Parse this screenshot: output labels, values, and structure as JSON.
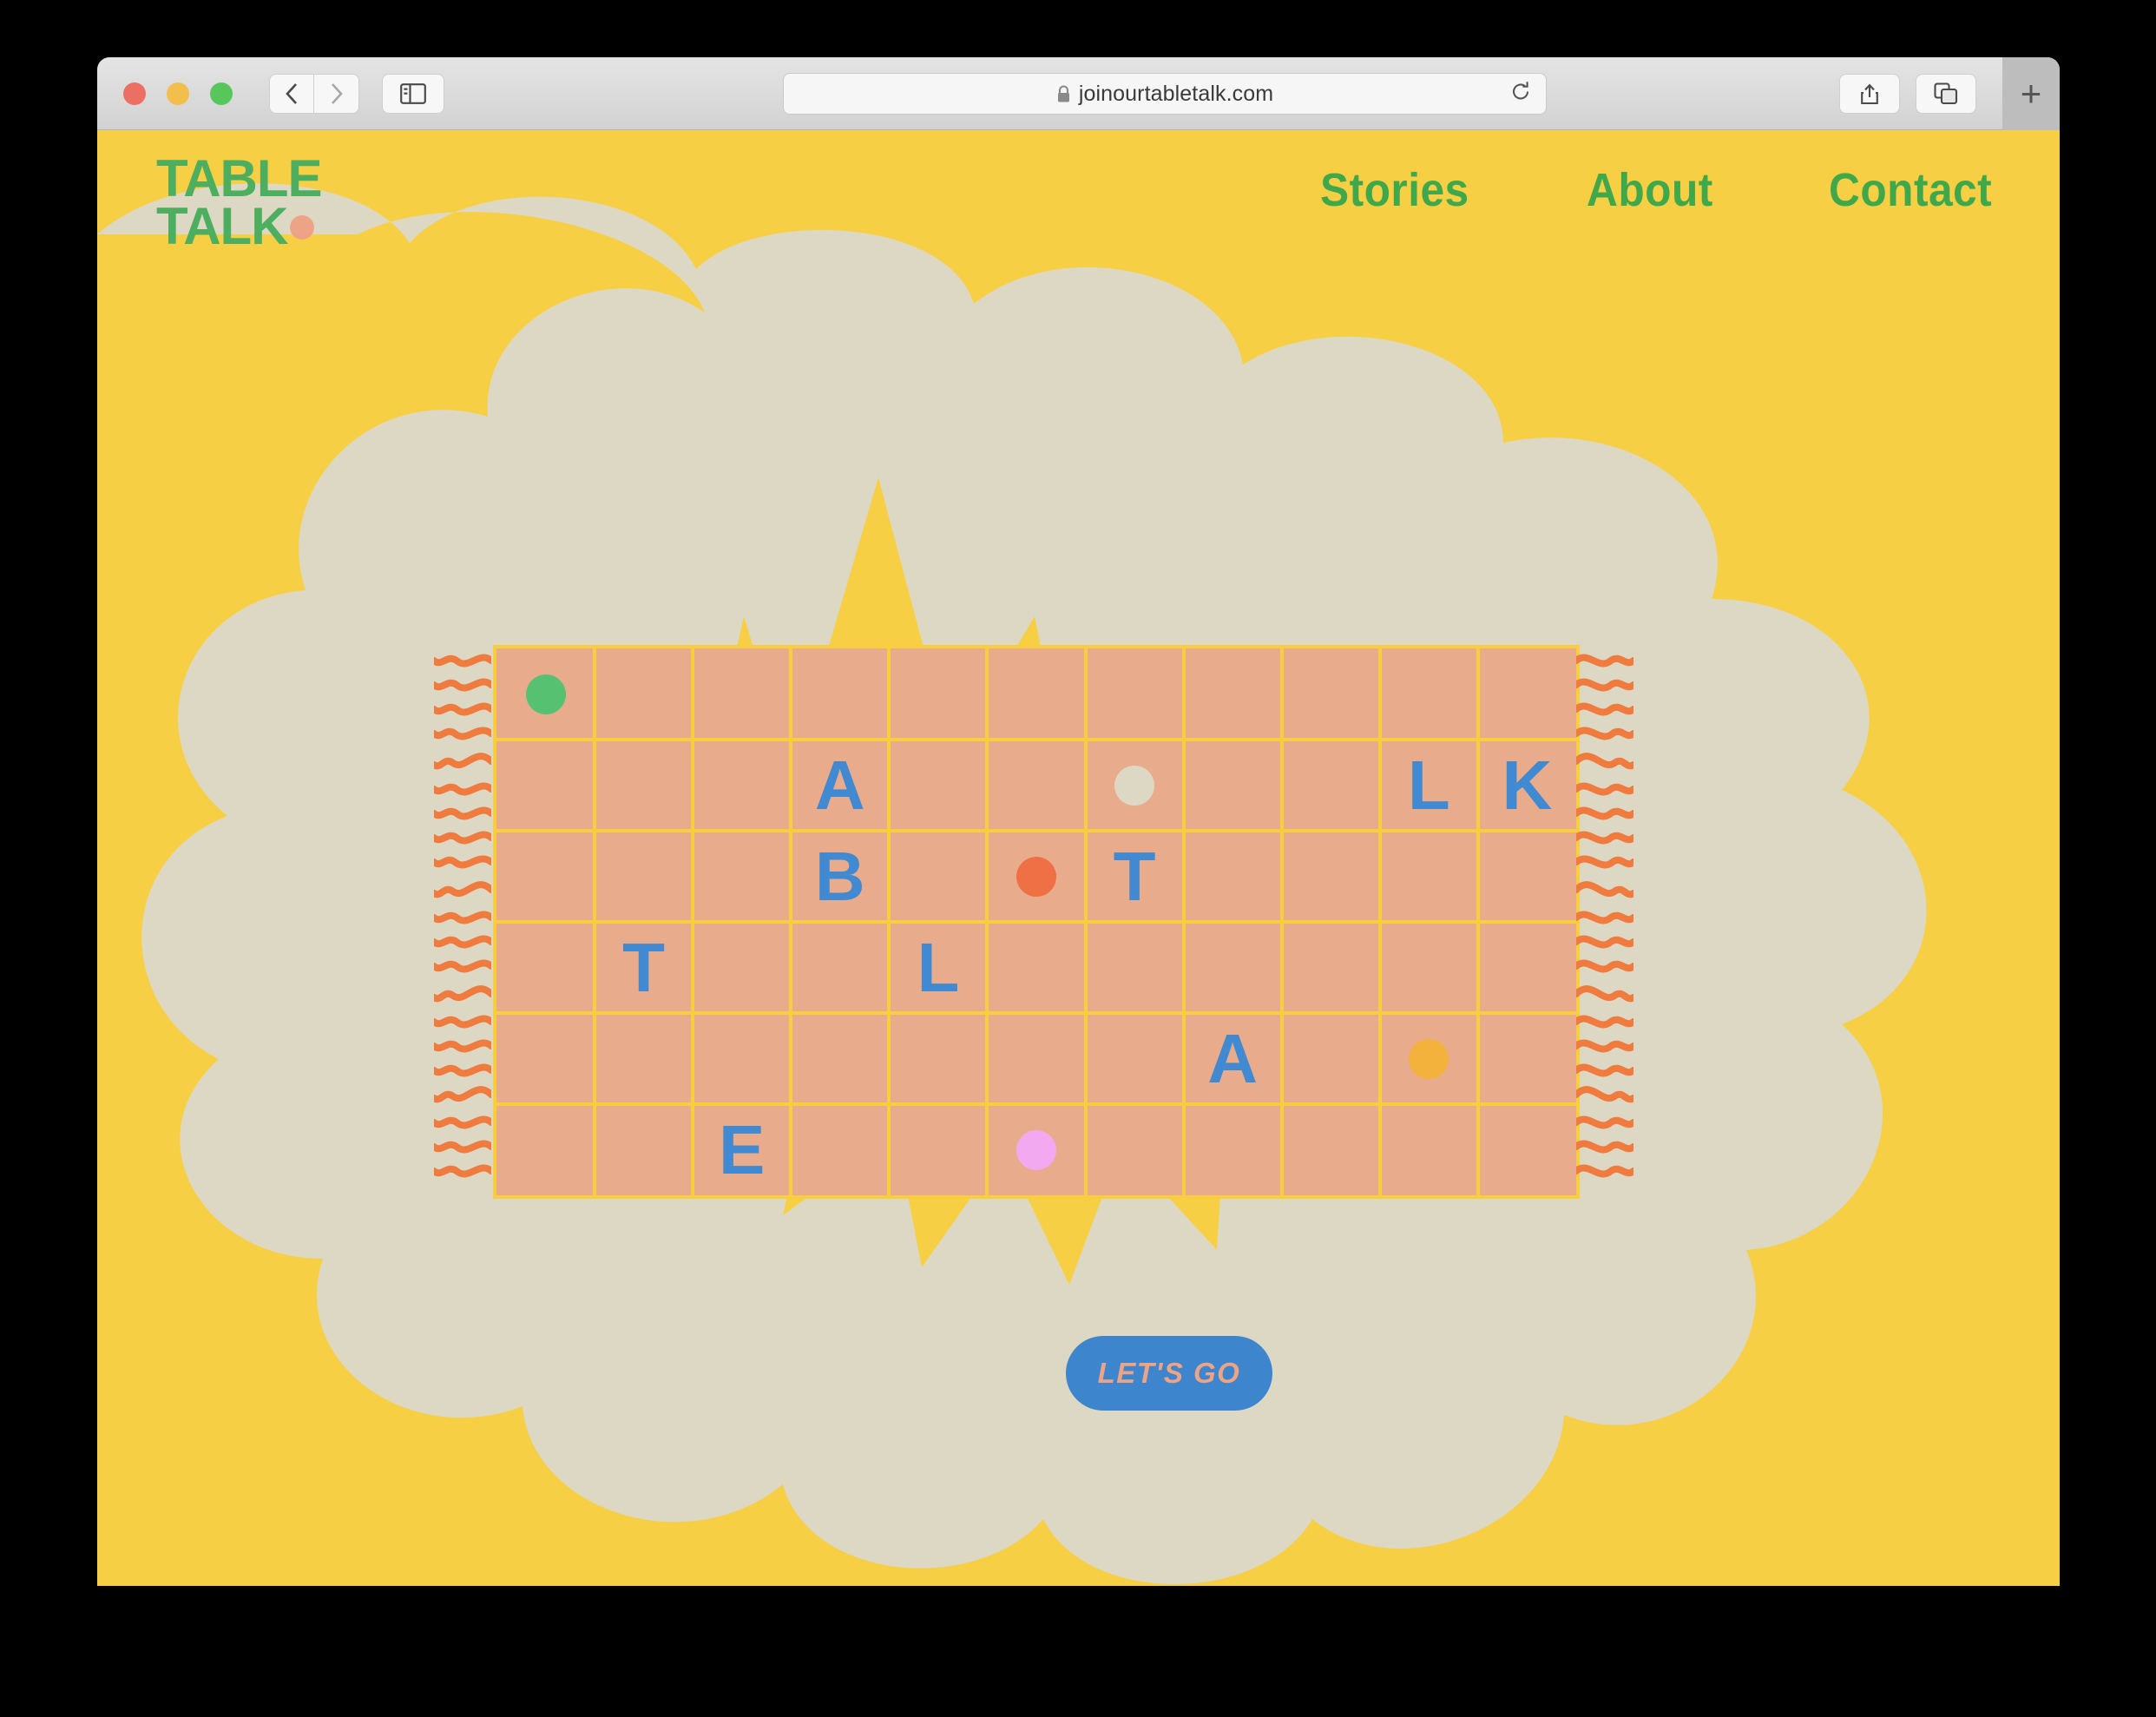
{
  "browser": {
    "url": "joinourtabletalk.com",
    "lock_icon": "lock-icon",
    "reload_icon": "reload-icon",
    "back_icon": "chevron-left-icon",
    "forward_icon": "chevron-right-icon",
    "sidebar_icon": "sidebar-icon",
    "share_icon": "share-icon",
    "tabs_icon": "tab-overview-icon",
    "new_tab_label": "+"
  },
  "site": {
    "logo": {
      "line1": "TABLE",
      "line2": "TALK"
    },
    "nav": [
      {
        "label": "Stories"
      },
      {
        "label": "About"
      },
      {
        "label": "Contact"
      }
    ],
    "cta": {
      "label": "LET'S GO"
    }
  },
  "colors": {
    "page_yellow": "#f7cf45",
    "cloud_beige": "#ddd8c4",
    "rug_salmon": "#e8ac8c",
    "rug_grid_yellow": "#f9ce3e",
    "letter_blue": "#4189d0",
    "brand_green": "#3fa84a",
    "accent_peach": "#eda385",
    "fringe_orange": "#ef7b3f",
    "cta_blue": "#3d85cc"
  },
  "rug": {
    "columns": 11,
    "rows": 6,
    "cells": [
      {
        "row": 1,
        "col": 1,
        "kind": "dot",
        "value": "",
        "color": "#56c271"
      },
      {
        "row": 2,
        "col": 4,
        "kind": "letter",
        "value": "A",
        "color": "#4189d0"
      },
      {
        "row": 2,
        "col": 7,
        "kind": "dot",
        "value": "",
        "color": "#ddd8c4"
      },
      {
        "row": 2,
        "col": 10,
        "kind": "letter",
        "value": "L",
        "color": "#4189d0"
      },
      {
        "row": 2,
        "col": 11,
        "kind": "letter",
        "value": "K",
        "color": "#4189d0"
      },
      {
        "row": 3,
        "col": 4,
        "kind": "letter",
        "value": "B",
        "color": "#4189d0"
      },
      {
        "row": 3,
        "col": 6,
        "kind": "dot",
        "value": "",
        "color": "#ef7045"
      },
      {
        "row": 3,
        "col": 7,
        "kind": "letter",
        "value": "T",
        "color": "#4189d0"
      },
      {
        "row": 4,
        "col": 2,
        "kind": "letter",
        "value": "T",
        "color": "#4189d0"
      },
      {
        "row": 4,
        "col": 5,
        "kind": "letter",
        "value": "L",
        "color": "#4189d0"
      },
      {
        "row": 5,
        "col": 8,
        "kind": "letter",
        "value": "A",
        "color": "#4189d0"
      },
      {
        "row": 5,
        "col": 10,
        "kind": "dot",
        "value": "",
        "color": "#f2b23c"
      },
      {
        "row": 6,
        "col": 3,
        "kind": "letter",
        "value": "E",
        "color": "#4189d0"
      },
      {
        "row": 6,
        "col": 6,
        "kind": "dot",
        "value": "",
        "color": "#f2a9ef"
      }
    ]
  }
}
